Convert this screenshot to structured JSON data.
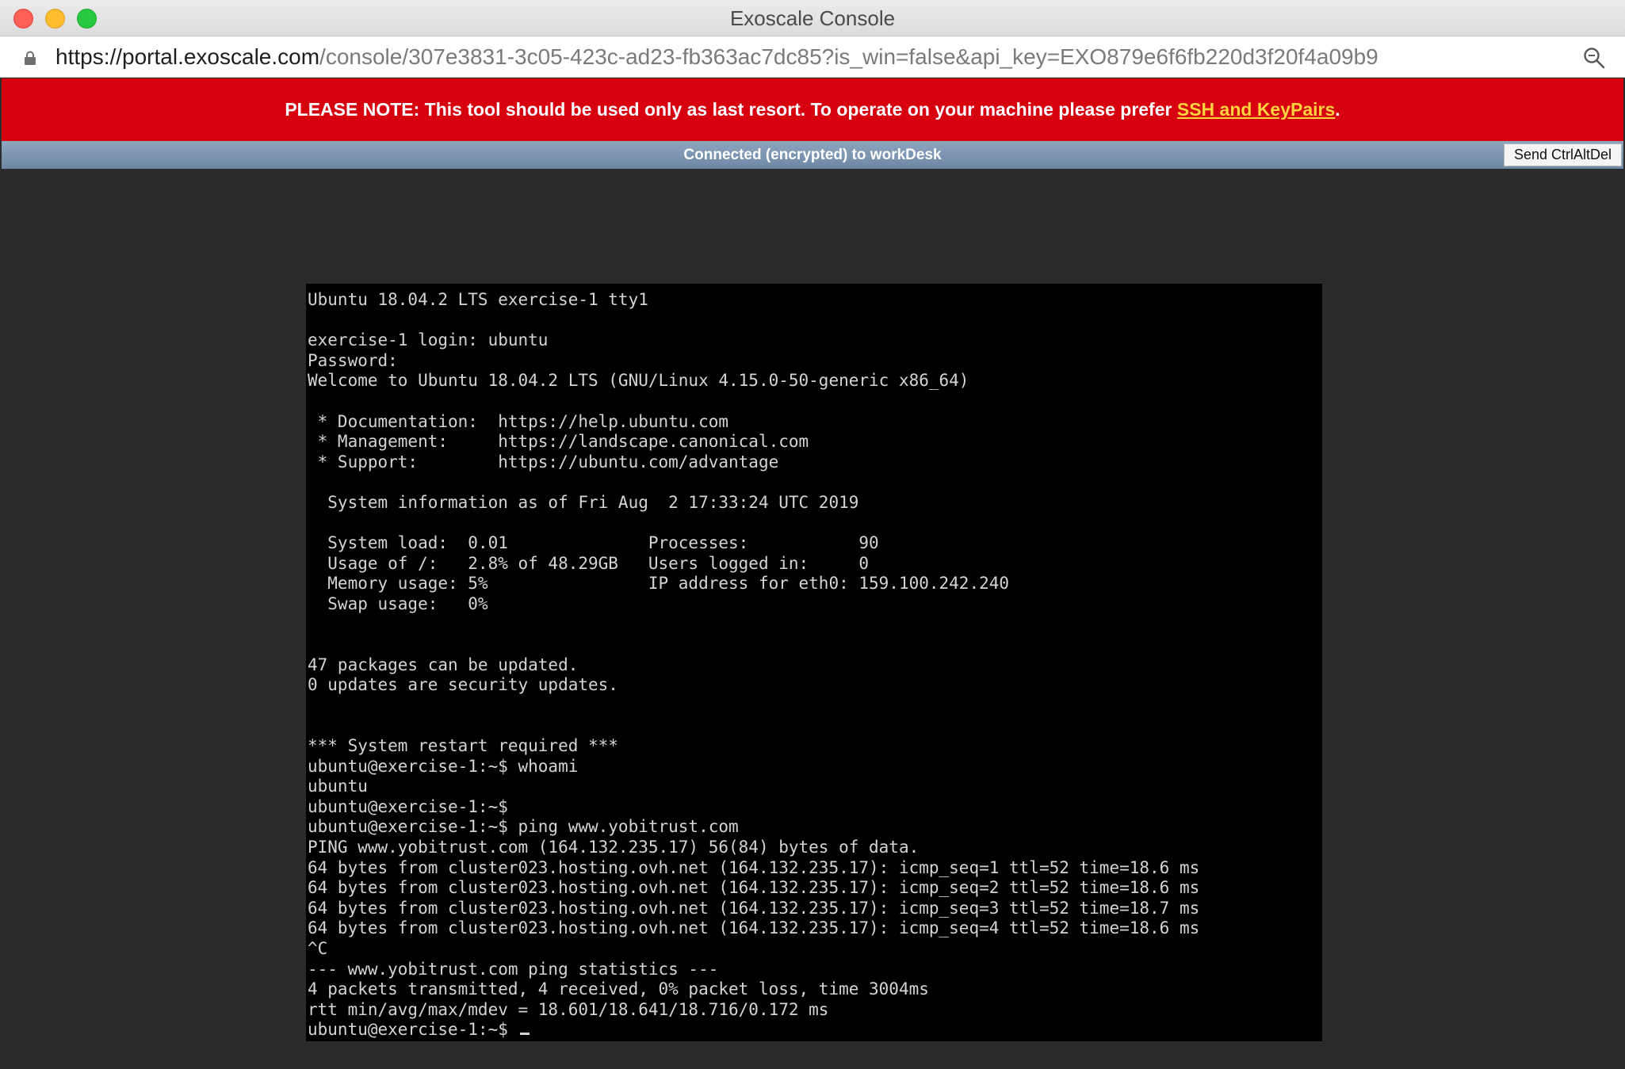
{
  "window": {
    "title": "Exoscale Console"
  },
  "address_bar": {
    "url_host": "https://portal.exoscale.com",
    "url_path": "/console/307e3831-3c05-423c-ad23-fb363ac7dc85?is_win=false&api_key=EXO879e6f6fb220d3f20f4a09b9",
    "lock_icon": "lock-icon",
    "search_icon": "magnifier-icon"
  },
  "notice": {
    "bold_prefix": "PLEASE NOTE:",
    "message": " This tool should be used only as last resort. To operate on your machine please prefer ",
    "link_text": "SSH and KeyPairs",
    "suffix": ".",
    "background_color": "#d7000f",
    "link_color": "#ffd33d"
  },
  "status_bar": {
    "text": "Connected (encrypted) to workDesk",
    "button_label": "Send CtrlAltDel"
  },
  "terminal": {
    "lines": [
      "Ubuntu 18.04.2 LTS exercise-1 tty1",
      "",
      "exercise-1 login: ubuntu",
      "Password:",
      "Welcome to Ubuntu 18.04.2 LTS (GNU/Linux 4.15.0-50-generic x86_64)",
      "",
      " * Documentation:  https://help.ubuntu.com",
      " * Management:     https://landscape.canonical.com",
      " * Support:        https://ubuntu.com/advantage",
      "",
      "  System information as of Fri Aug  2 17:33:24 UTC 2019",
      "",
      "  System load:  0.01              Processes:           90",
      "  Usage of /:   2.8% of 48.29GB   Users logged in:     0",
      "  Memory usage: 5%                IP address for eth0: 159.100.242.240",
      "  Swap usage:   0%",
      "",
      "",
      "47 packages can be updated.",
      "0 updates are security updates.",
      "",
      "",
      "*** System restart required ***",
      "ubuntu@exercise-1:~$ whoami",
      "ubuntu",
      "ubuntu@exercise-1:~$",
      "ubuntu@exercise-1:~$ ping www.yobitrust.com",
      "PING www.yobitrust.com (164.132.235.17) 56(84) bytes of data.",
      "64 bytes from cluster023.hosting.ovh.net (164.132.235.17): icmp_seq=1 ttl=52 time=18.6 ms",
      "64 bytes from cluster023.hosting.ovh.net (164.132.235.17): icmp_seq=2 ttl=52 time=18.6 ms",
      "64 bytes from cluster023.hosting.ovh.net (164.132.235.17): icmp_seq=3 ttl=52 time=18.7 ms",
      "64 bytes from cluster023.hosting.ovh.net (164.132.235.17): icmp_seq=4 ttl=52 time=18.6 ms",
      "^C",
      "--- www.yobitrust.com ping statistics ---",
      "4 packets transmitted, 4 received, 0% packet loss, time 3004ms",
      "rtt min/avg/max/mdev = 18.601/18.641/18.716/0.172 ms"
    ],
    "prompt": "ubuntu@exercise-1:~$ "
  }
}
